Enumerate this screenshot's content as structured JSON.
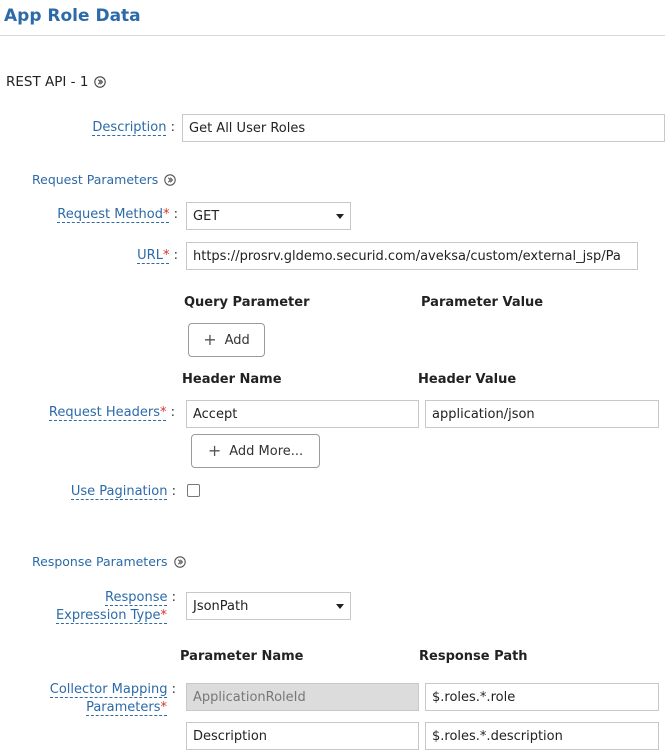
{
  "header": {
    "title": "App Role Data"
  },
  "section": {
    "title": "REST API - 1"
  },
  "description": {
    "label": "Description",
    "value": "Get All User Roles"
  },
  "request": {
    "title": "Request Parameters",
    "method_label": "Request Method",
    "method_value": "GET",
    "url_label": "URL",
    "url_value": "https://prosrv.gldemo.securid.com/aveksa/custom/external_jsp/Pa",
    "query_param_col": "Query Parameter",
    "param_value_col": "Parameter Value",
    "add_label": "Add",
    "header_name_col": "Header Name",
    "header_value_col": "Header Value",
    "headers_label": "Request Headers",
    "header_rows": [
      {
        "name": "Accept",
        "value": "application/json"
      }
    ],
    "add_more_label": "Add More...",
    "pagination_label": "Use Pagination"
  },
  "response": {
    "title": "Response Parameters",
    "expr_label_1": "Response",
    "expr_label_2": "Expression Type",
    "expr_value": "JsonPath",
    "param_name_col": "Parameter Name",
    "response_path_col": "Response Path",
    "mapping_label_1": "Collector Mapping",
    "mapping_label_2": "Parameters",
    "mapping_rows": [
      {
        "name": "ApplicationRoleId",
        "path": "$.roles.*.role"
      },
      {
        "name": "Description",
        "path": "$.roles.*.description"
      }
    ]
  }
}
